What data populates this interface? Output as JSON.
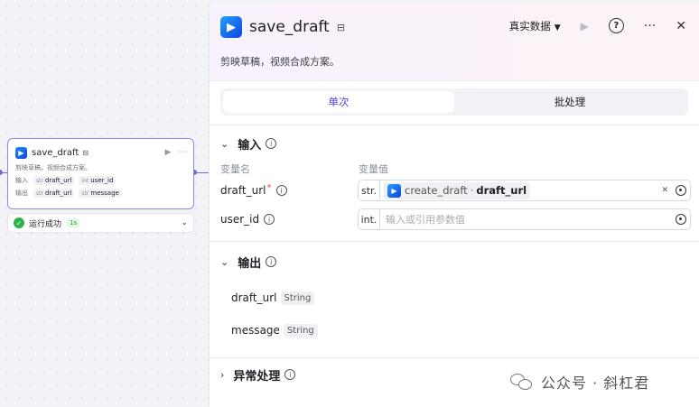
{
  "node": {
    "title": "save_draft",
    "description": "剪映草稿，视频合成方案。",
    "input_label": "输入",
    "output_label": "输出",
    "inputs": [
      {
        "type": "str",
        "name": "draft_url"
      },
      {
        "type": "int",
        "name": "user_id"
      }
    ],
    "outputs": [
      {
        "type": "str",
        "name": "draft_url"
      },
      {
        "type": "str",
        "name": "message"
      }
    ],
    "status": "运行成功",
    "duration": "1s",
    "more": "···",
    "run": "▶",
    "save_glyph": "⊟"
  },
  "panel": {
    "title": "save_draft",
    "save_glyph": "⊟",
    "data_mode": "真实数据",
    "description": "剪映草稿，视频合成方案。",
    "help": "?",
    "more": "···",
    "close": "✕",
    "run": "▶",
    "tabs": [
      {
        "label": "单次",
        "active": true
      },
      {
        "label": "批处理",
        "active": false
      }
    ],
    "input_section": {
      "title": "输入",
      "col_name": "变量名",
      "col_value": "变量值",
      "params": [
        {
          "name": "draft_url",
          "required": true,
          "type": "str.",
          "ref_node": "create_draft",
          "ref_sep": "·",
          "ref_field": "draft_url"
        },
        {
          "name": "user_id",
          "required": false,
          "type": "int.",
          "placeholder": "输入或引用参数值"
        }
      ]
    },
    "output_section": {
      "title": "输出",
      "items": [
        {
          "name": "draft_url",
          "type": "String"
        },
        {
          "name": "message",
          "type": "String"
        }
      ]
    },
    "exception_section": {
      "title": "异常处理"
    }
  },
  "watermark": {
    "text": "公众号 · 斜杠君"
  },
  "colors": {
    "accent": "#4e40e5",
    "node_border": "#8b8ce8",
    "success": "#2db24a",
    "required": "#e5484d"
  }
}
